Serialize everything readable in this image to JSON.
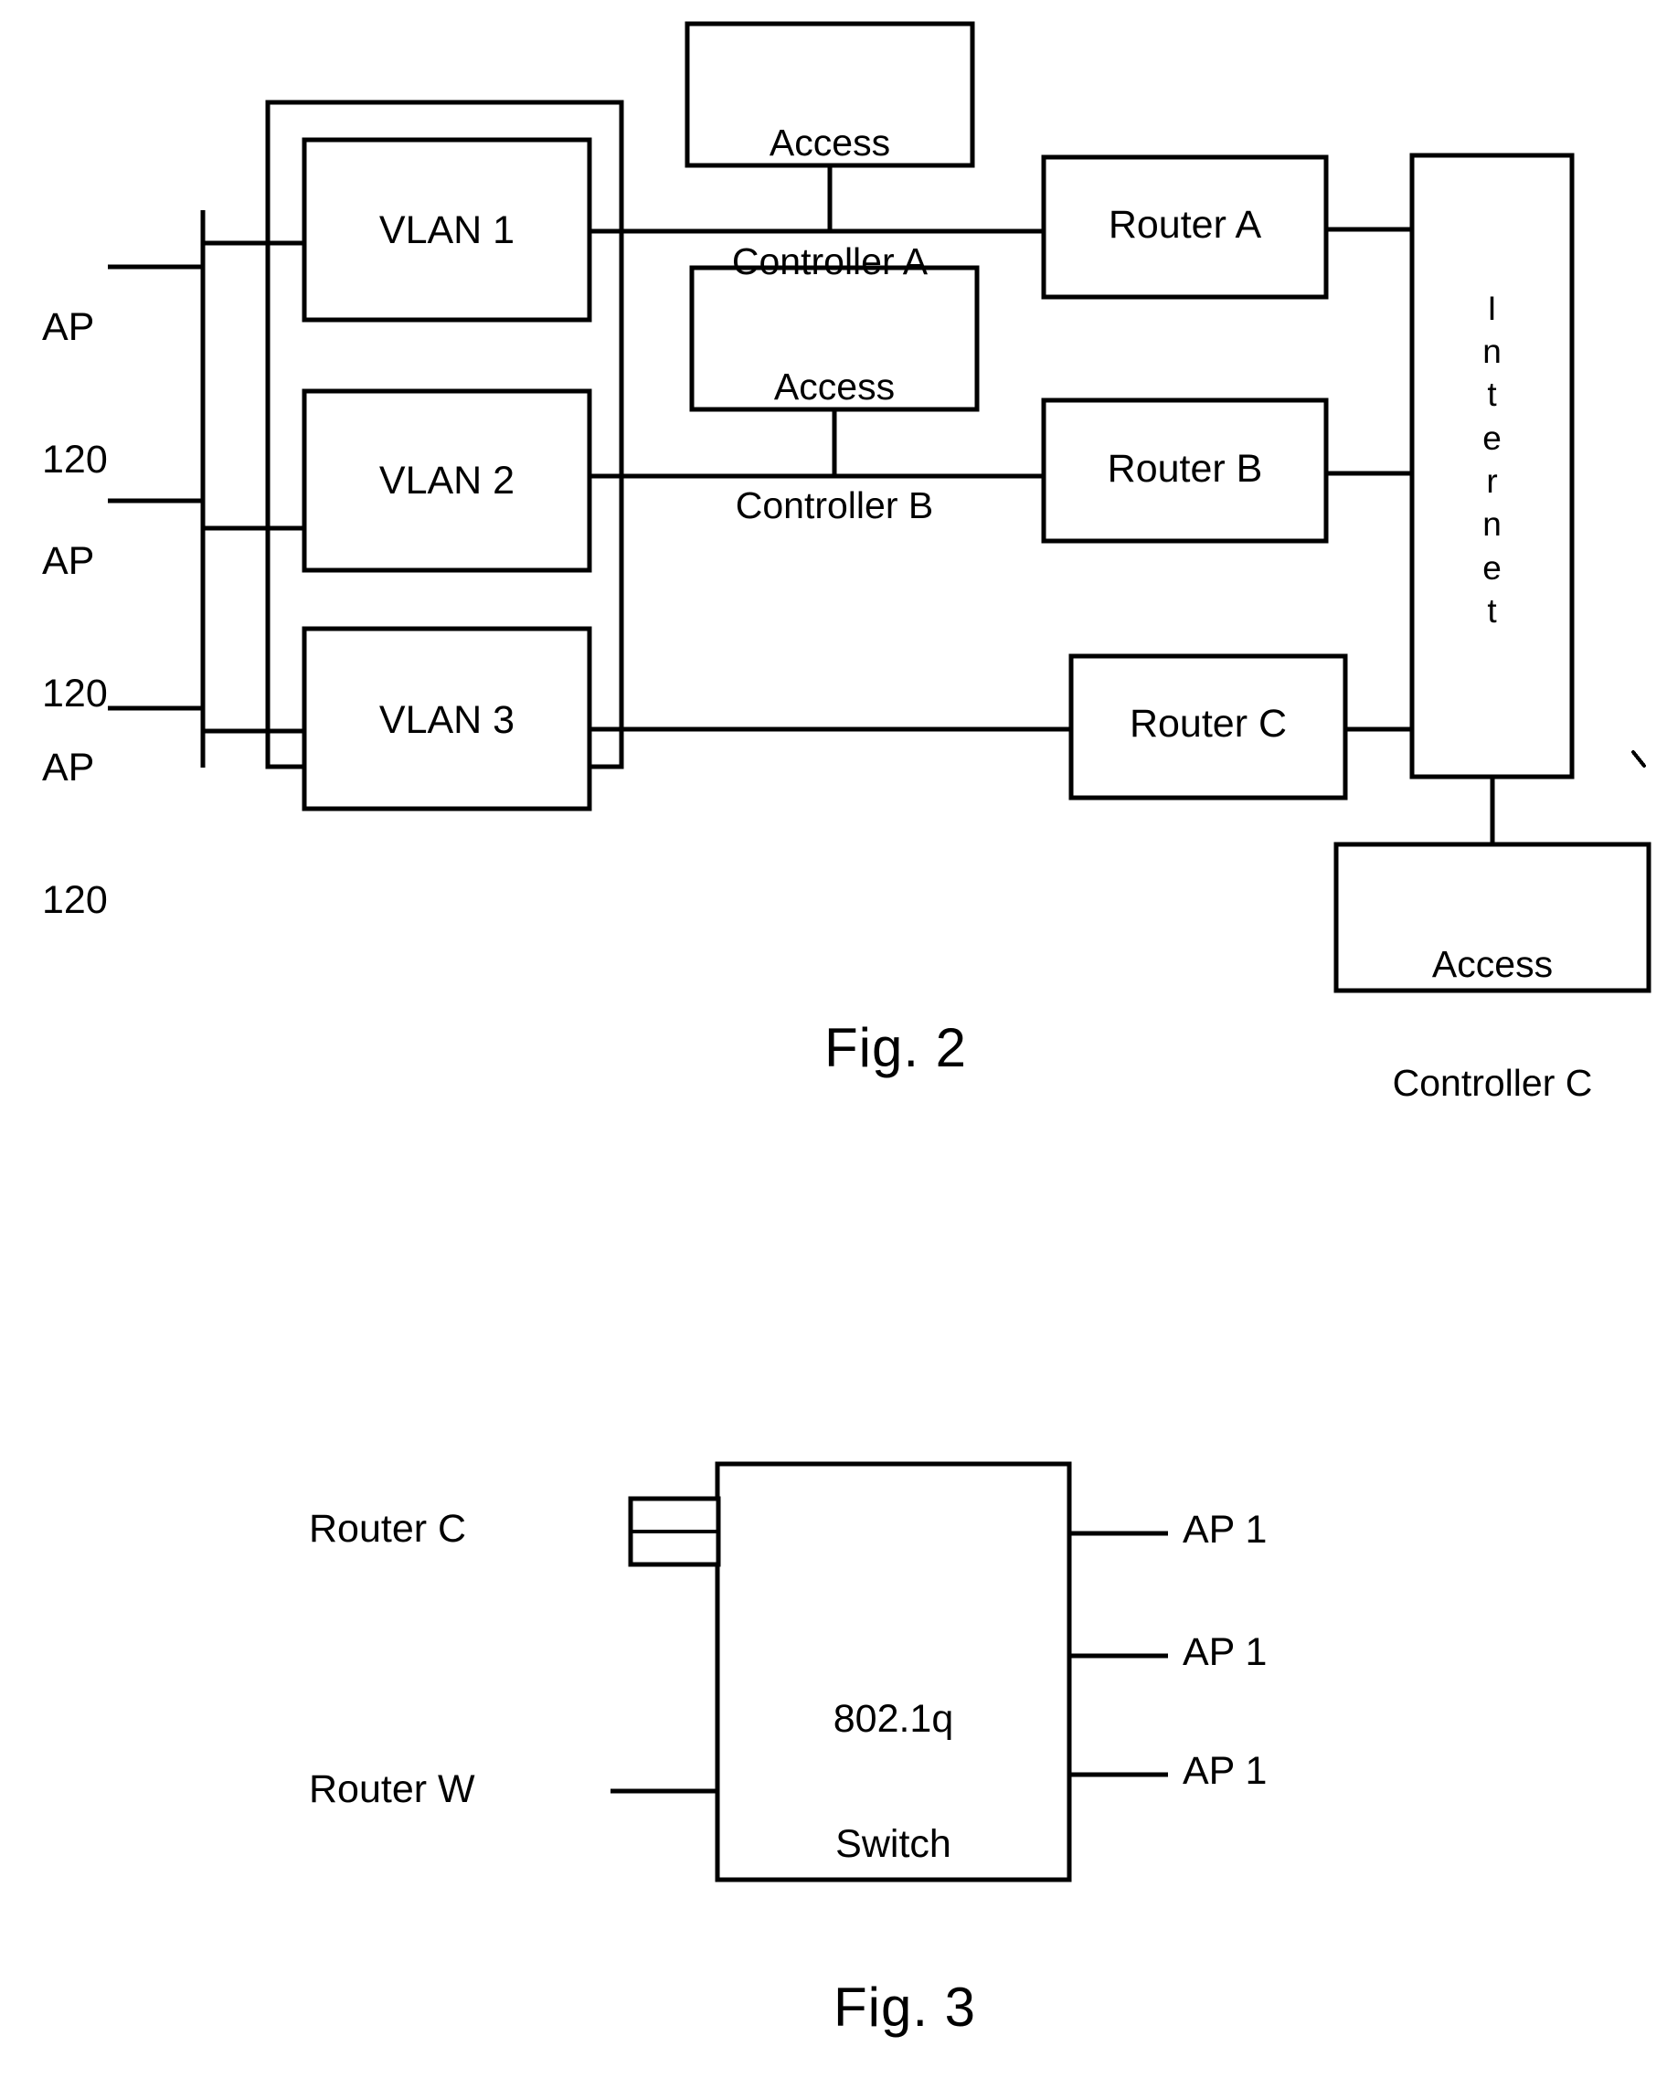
{
  "figure2": {
    "caption": "Fig. 2",
    "access_points": [
      {
        "line1": "AP",
        "line2": "120"
      },
      {
        "line1": "AP",
        "line2": "120"
      },
      {
        "line1": "AP",
        "line2": "120"
      }
    ],
    "vlans": [
      {
        "label": "VLAN 1"
      },
      {
        "label": "VLAN 2"
      },
      {
        "label": "VLAN 3"
      }
    ],
    "access_controllers": [
      {
        "line1": "Access",
        "line2": "Controller A"
      },
      {
        "line1": "Access",
        "line2": "Controller B"
      },
      {
        "line1": "Access",
        "line2": "Controller C"
      }
    ],
    "routers": [
      {
        "label": "Router A"
      },
      {
        "label": "Router B"
      },
      {
        "label": "Router C"
      }
    ],
    "internet": {
      "label": "Internet",
      "letters": [
        "I",
        "n",
        "t",
        "e",
        "r",
        "n",
        "e",
        "t"
      ]
    }
  },
  "figure3": {
    "caption": "Fig. 3",
    "switch": {
      "line1": "802.1q",
      "line2": "Switch"
    },
    "left_ports": [
      {
        "label": "Router C"
      },
      {
        "label": "Router W"
      }
    ],
    "right_ports": [
      {
        "label": "AP 1"
      },
      {
        "label": "AP 1"
      },
      {
        "label": "AP 1"
      }
    ]
  },
  "style": {
    "ink": "#000000",
    "paper": "#ffffff"
  }
}
